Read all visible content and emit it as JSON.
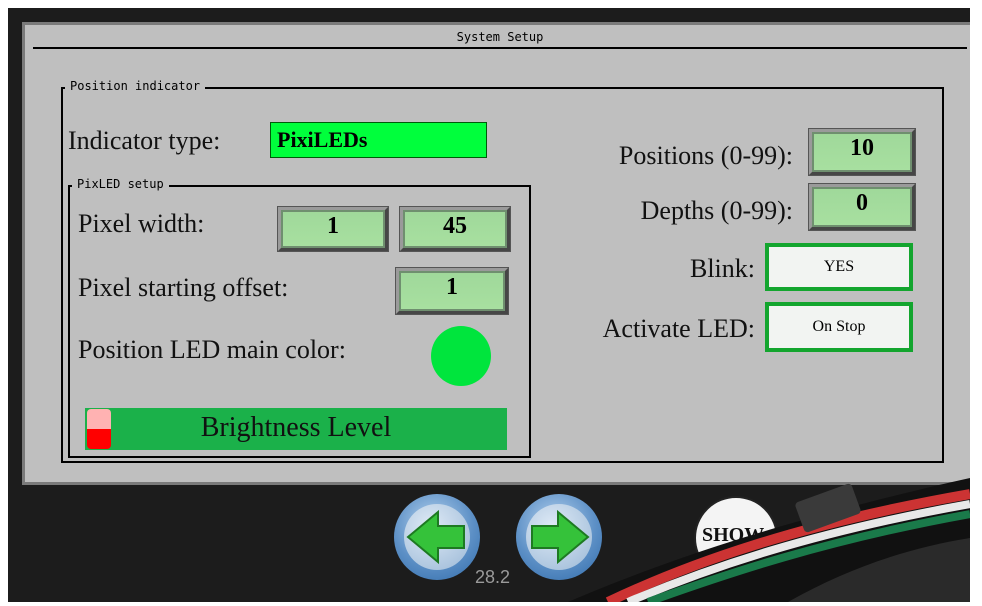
{
  "screen": {
    "title": "System Setup"
  },
  "position_indicator": {
    "legend": "Position indicator",
    "indicator_type": {
      "label": "Indicator type:",
      "value": "PixiLEDs"
    },
    "pixled_setup": {
      "legend": "PixLED setup",
      "pixel_width": {
        "label": "Pixel width:",
        "value_1": "1",
        "value_2": "45"
      },
      "pixel_offset": {
        "label": "Pixel starting offset:",
        "value": "1"
      },
      "main_color": {
        "label": "Position LED main color:",
        "color": "#00e53d"
      },
      "brightness": {
        "label": "Brightness Level",
        "level_fraction": 0.0
      }
    },
    "positions": {
      "label": "Positions (0-99):",
      "value": "10"
    },
    "depths": {
      "label": "Depths (0-99):",
      "value": "0"
    },
    "blink": {
      "label": "Blink:",
      "value": "YES"
    },
    "activate_led": {
      "label": "Activate LED:",
      "value": "On Stop"
    }
  },
  "bottom_bar": {
    "version": "28.2",
    "show_label": "SHOW",
    "prev_icon": "left-arrow-icon",
    "next_icon": "right-arrow-icon"
  },
  "colors": {
    "accent_green": "#00ff3c",
    "button_border": "#13a52e",
    "brightness_bar": "#1bb14a"
  }
}
